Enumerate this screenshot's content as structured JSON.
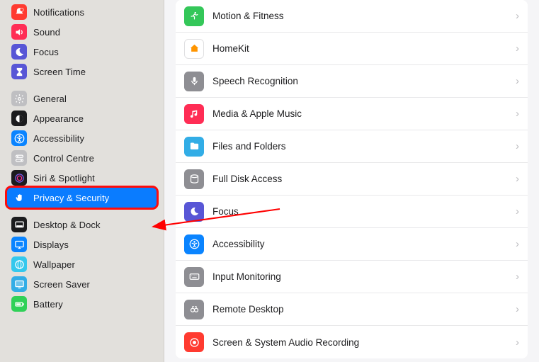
{
  "sidebar": {
    "groups": [
      {
        "items": [
          {
            "label": "Notifications",
            "iconName": "bell-badge-icon",
            "iconBg": "#ff3b30",
            "iconFg": "#fff"
          },
          {
            "label": "Sound",
            "iconName": "speaker-icon",
            "iconBg": "#ff2d55",
            "iconFg": "#fff"
          },
          {
            "label": "Focus",
            "iconName": "moon-icon",
            "iconBg": "#5856d6",
            "iconFg": "#fff"
          },
          {
            "label": "Screen Time",
            "iconName": "hourglass-icon",
            "iconBg": "#5856d6",
            "iconFg": "#fff"
          }
        ]
      },
      {
        "items": [
          {
            "label": "General",
            "iconName": "gear-icon",
            "iconBg": "#bfbfc2",
            "iconFg": "#fff"
          },
          {
            "label": "Appearance",
            "iconName": "appearance-icon",
            "iconBg": "#1c1c1e",
            "iconFg": "#fff"
          },
          {
            "label": "Accessibility",
            "iconName": "accessibility-icon",
            "iconBg": "#0a84ff",
            "iconFg": "#fff"
          },
          {
            "label": "Control Centre",
            "iconName": "control-centre-icon",
            "iconBg": "#bfbfc2",
            "iconFg": "#fff"
          },
          {
            "label": "Siri & Spotlight",
            "iconName": "siri-icon",
            "iconBg": "#1c1c1e",
            "iconFg": "#fff"
          },
          {
            "label": "Privacy & Security",
            "iconName": "hand-icon",
            "iconBg": "#0a7cff",
            "iconFg": "#fff",
            "selected": true
          }
        ]
      },
      {
        "items": [
          {
            "label": "Desktop & Dock",
            "iconName": "dock-icon",
            "iconBg": "#1c1c1e",
            "iconFg": "#fff"
          },
          {
            "label": "Displays",
            "iconName": "displays-icon",
            "iconBg": "#0a84ff",
            "iconFg": "#fff"
          },
          {
            "label": "Wallpaper",
            "iconName": "wallpaper-icon",
            "iconBg": "#34c8ed",
            "iconFg": "#fff"
          },
          {
            "label": "Screen Saver",
            "iconName": "screensaver-icon",
            "iconBg": "#32ade6",
            "iconFg": "#fff"
          },
          {
            "label": "Battery",
            "iconName": "battery-icon",
            "iconBg": "#30d158",
            "iconFg": "#fff"
          }
        ]
      }
    ]
  },
  "main": {
    "rows": [
      {
        "label": "Motion & Fitness",
        "iconName": "running-icon",
        "iconBg": "#34c759",
        "iconFg": "#fff"
      },
      {
        "label": "HomeKit",
        "iconName": "home-icon",
        "iconBg": "#ffffff",
        "iconFg": "#ff9500",
        "border": true
      },
      {
        "label": "Speech Recognition",
        "iconName": "microphone-icon",
        "iconBg": "#8e8e93",
        "iconFg": "#fff"
      },
      {
        "label": "Media & Apple Music",
        "iconName": "music-icon",
        "iconBg": "#ff2d55",
        "iconFg": "#fff"
      },
      {
        "label": "Files and Folders",
        "iconName": "folder-icon",
        "iconBg": "#32ade6",
        "iconFg": "#fff"
      },
      {
        "label": "Full Disk Access",
        "iconName": "disk-icon",
        "iconBg": "#8e8e93",
        "iconFg": "#fff"
      },
      {
        "label": "Focus",
        "iconName": "moon-icon",
        "iconBg": "#5856d6",
        "iconFg": "#fff"
      },
      {
        "label": "Accessibility",
        "iconName": "accessibility-icon",
        "iconBg": "#0a84ff",
        "iconFg": "#fff"
      },
      {
        "label": "Input Monitoring",
        "iconName": "keyboard-icon",
        "iconBg": "#8e8e93",
        "iconFg": "#fff"
      },
      {
        "label": "Remote Desktop",
        "iconName": "binoculars-icon",
        "iconBg": "#8e8e93",
        "iconFg": "#fff"
      },
      {
        "label": "Screen & System Audio Recording",
        "iconName": "record-icon",
        "iconBg": "#ff3b30",
        "iconFg": "#fff"
      }
    ]
  },
  "annotation": {
    "description": "Red arrow pointing from Focus row to Privacy & Security sidebar item"
  }
}
